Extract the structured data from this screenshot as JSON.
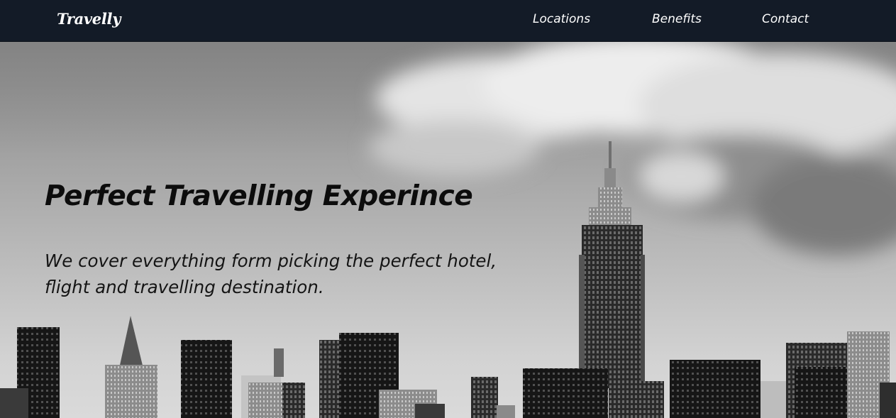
{
  "header": {
    "logo": "Travelly",
    "nav": [
      {
        "label": "Locations"
      },
      {
        "label": "Benefits"
      },
      {
        "label": "Contact"
      }
    ]
  },
  "hero": {
    "title": "Perfect Travelling Experince",
    "subtitle": "We cover everything form picking the perfect hotel, flight and travelling destination."
  },
  "colors": {
    "header_bg": "#131b27",
    "header_text": "#ffffff",
    "hero_text": "#0c0c0c"
  }
}
